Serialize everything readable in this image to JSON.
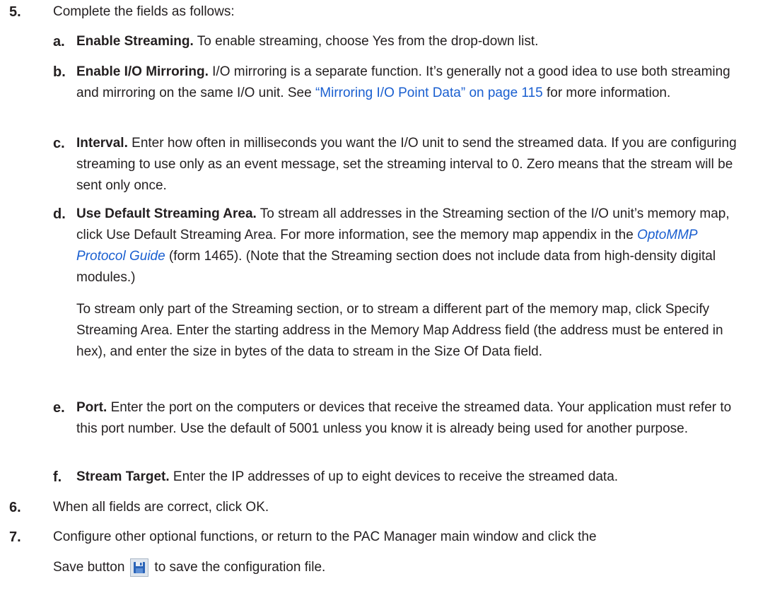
{
  "steps": [
    {
      "number": "5.",
      "text": "Complete the fields as follows:"
    },
    {
      "number": "6.",
      "text": "When all fields are correct, click OK."
    },
    {
      "number": "7.",
      "text_line1": "Configure other optional functions, or return to the PAC Manager main window and click the",
      "text_before_icon": "Save button",
      "text_after_icon": "to save the configuration file."
    }
  ],
  "fields": {
    "a": {
      "letter": "a.",
      "term": "Enable Streaming.",
      "text": "To enable streaming, choose Yes from the drop-down list."
    },
    "b": {
      "letter": "b.",
      "term": "Enable I/O Mirroring.",
      "text1": "I/O mirroring is a separate function. It’s generally not a good idea to use both streaming and mirroring on the same I/O unit. See",
      "link": "“Mirroring I/O Point Data” on page 115",
      "text2": "for more information."
    },
    "c": {
      "letter": "c.",
      "term": "Interval.",
      "text": "Enter how often in milliseconds you want the I/O unit to send the streamed data. If you are configuring streaming to use only as an event message, set the streaming interval to 0. Zero means that the stream will be sent only once."
    },
    "d": {
      "letter": "d.",
      "term": "Use Default Streaming Area.",
      "text1": "To stream all addresses in the Streaming section of the I/O unit’s memory map, click Use Default Streaming Area. For more information, see the memory map appendix in the",
      "link": "OptoMMP Protocol Guide",
      "text2": "(form 1465). (Note that the Streaming section does not include data from high-density digital modules.)",
      "para2": "To stream only part of the Streaming section, or to stream a different part of the memory map, click Specify Streaming Area. Enter the starting address in the Memory Map Address field (the address must be entered in hex), and enter the size in bytes of the data to stream in the Size Of Data field."
    },
    "e": {
      "letter": "e.",
      "term": "Port.",
      "text": "Enter the port on the computers or devices that receive the streamed data. Your application must refer to this port number. Use the default of 5001 unless you know it is already being used for another purpose."
    },
    "f": {
      "letter": "f.",
      "term": "Stream Target.",
      "text": "Enter the IP addresses of up to eight devices to receive the streamed data."
    }
  },
  "icons": {
    "save": "save-disk-icon"
  },
  "colors": {
    "text": "#231f20",
    "link": "#1a5fd0"
  }
}
